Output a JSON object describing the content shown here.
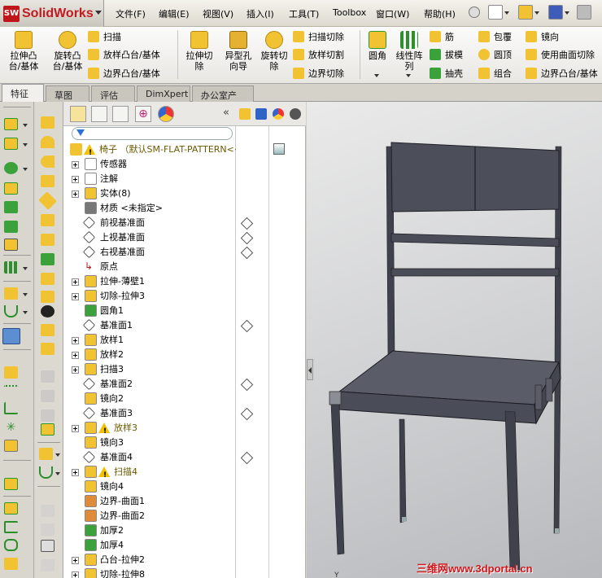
{
  "app": {
    "name": "SolidWorks"
  },
  "menu": [
    "文件(F)",
    "编辑(E)",
    "视图(V)",
    "插入(I)",
    "工具(T)",
    "Toolbox",
    "窗口(W)",
    "帮助(H)"
  ],
  "ribbon": {
    "big": [
      "拉伸凸\n台/基体",
      "旋转凸\n台/基体",
      "拉伸切\n除",
      "异型孔\n向导",
      "旋转切\n除",
      "圆角",
      "线性阵\n列"
    ],
    "small": [
      "扫描",
      "放样凸台/基体",
      "边界凸台/基体",
      "扫描切除",
      "放样切割",
      "边界切除",
      "筋",
      "拔模",
      "抽壳",
      "包覆",
      "圆顶",
      "组合",
      "镜向",
      "使用曲面切除",
      "边界凸台/基体"
    ]
  },
  "tabs": [
    "特征",
    "草图",
    "评估",
    "DimXpert",
    "办公室产品"
  ],
  "tree": {
    "root": "椅子  （默认SM-FLAT-PATTERN<<",
    "items": [
      "传感器",
      "注解",
      "实体(8)",
      "材质 <未指定>",
      "前视基准面",
      "上视基准面",
      "右视基准面",
      "原点",
      "拉伸-薄壁1",
      "切除-拉伸3",
      "圆角1",
      "基准面1",
      "放样1",
      "放样2",
      "扫描3",
      "基准面2",
      "镜向2",
      "基准面3",
      "放样3",
      "镜向3",
      "基准面4",
      "扫描4",
      "镜向4",
      "边界-曲面1",
      "边界-曲面2",
      "加厚2",
      "加厚4",
      "凸台-拉伸2",
      "切除-拉伸8"
    ]
  },
  "viewport": {
    "axis_label": "Y"
  },
  "watermark": "三维网www.3dportal.cn",
  "colors": {
    "accent": "#c0161b",
    "chair": "#4a4c58",
    "warn": "#f2c200"
  }
}
